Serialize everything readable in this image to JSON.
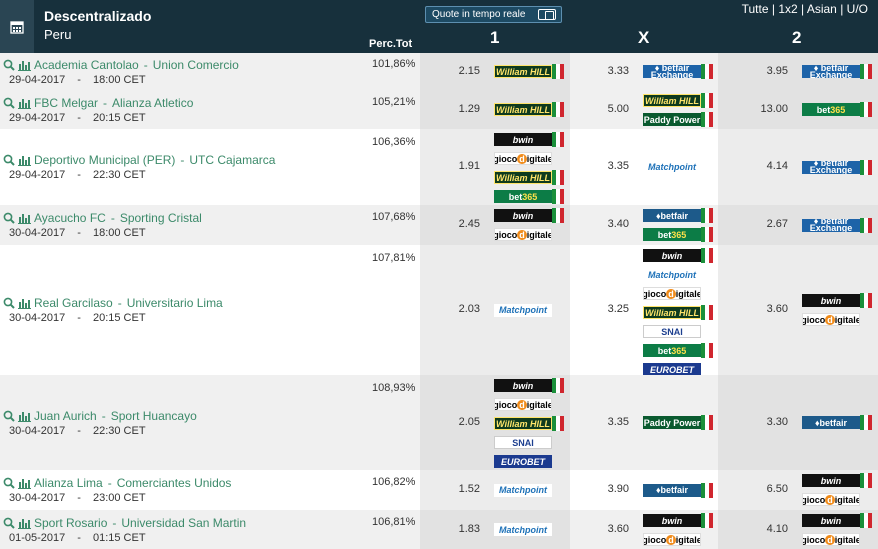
{
  "header": {
    "title": "Descentralizado",
    "subtitle": "Peru",
    "live_label": "Quote in tempo reale",
    "filters": [
      "Tutte",
      "1x2",
      "Asian",
      "U/O"
    ],
    "perc_label": "Perc.Tot",
    "col1": "1",
    "colx": "X",
    "col2": "2"
  },
  "matches": [
    {
      "home": "Academia Cantolao",
      "away": "Union Comercio",
      "date": "29-04-2017",
      "time": "18:00 CET",
      "perc": "101,86%",
      "odd1": "2.15",
      "oddx": "3.33",
      "odd2": "3.95",
      "bk1": [
        "William Hill"
      ],
      "bkx": [
        "betfair Exchange"
      ],
      "bk2": [
        "betfair Exchange"
      ]
    },
    {
      "home": "FBC Melgar",
      "away": "Alianza Atletico",
      "date": "29-04-2017",
      "time": "20:15 CET",
      "perc": "105,21%",
      "odd1": "1.29",
      "oddx": "5.00",
      "odd2": "13.00",
      "bk1": [
        "William Hill"
      ],
      "bkx": [
        "William Hill",
        "Paddy Power"
      ],
      "bk2": [
        "bet365"
      ]
    },
    {
      "home": "Deportivo Municipal (PER)",
      "away": "UTC Cajamarca",
      "date": "29-04-2017",
      "time": "22:30 CET",
      "perc": "106,36%",
      "odd1": "1.91",
      "oddx": "3.35",
      "odd2": "4.14",
      "bk1": [
        "bwin",
        "gioco digitale",
        "William Hill",
        "bet365"
      ],
      "bkx": [
        "Matchpoint"
      ],
      "bk2": [
        "betfair Exchange"
      ]
    },
    {
      "home": "Ayacucho FC",
      "away": "Sporting Cristal",
      "date": "30-04-2017",
      "time": "18:00 CET",
      "perc": "107,68%",
      "odd1": "2.45",
      "oddx": "3.40",
      "odd2": "2.67",
      "bk1": [
        "bwin",
        "gioco digitale"
      ],
      "bkx": [
        "betfair",
        "bet365"
      ],
      "bk2": [
        "betfair Exchange"
      ]
    },
    {
      "home": "Real Garcilaso",
      "away": "Universitario Lima",
      "date": "30-04-2017",
      "time": "20:15 CET",
      "perc": "107,81%",
      "odd1": "2.03",
      "oddx": "3.25",
      "odd2": "3.60",
      "bk1": [
        "Matchpoint"
      ],
      "bkx": [
        "bwin",
        "Matchpoint",
        "gioco digitale",
        "William Hill",
        "SNAI",
        "bet365",
        "EUROBET"
      ],
      "bk2": [
        "bwin",
        "gioco digitale"
      ]
    },
    {
      "home": "Juan Aurich",
      "away": "Sport Huancayo",
      "date": "30-04-2017",
      "time": "22:30 CET",
      "perc": "108,93%",
      "odd1": "2.05",
      "oddx": "3.35",
      "odd2": "3.30",
      "bk1": [
        "bwin",
        "gioco digitale",
        "William Hill",
        "SNAI",
        "EUROBET"
      ],
      "bkx": [
        "Paddy Power"
      ],
      "bk2": [
        "betfair"
      ]
    },
    {
      "home": "Alianza Lima",
      "away": "Comerciantes Unidos",
      "date": "30-04-2017",
      "time": "23:00 CET",
      "perc": "106,82%",
      "odd1": "1.52",
      "oddx": "3.90",
      "odd2": "6.50",
      "bk1": [
        "Matchpoint"
      ],
      "bkx": [
        "betfair"
      ],
      "bk2": [
        "bwin",
        "gioco digitale"
      ]
    },
    {
      "home": "Sport Rosario",
      "away": "Universidad San Martin",
      "date": "01-05-2017",
      "time": "01:15 CET",
      "perc": "106,81%",
      "odd1": "1.83",
      "oddx": "3.60",
      "odd2": "4.10",
      "bk1": [
        "Matchpoint"
      ],
      "bkx": [
        "bwin",
        "gioco digitale"
      ],
      "bk2": [
        "bwin",
        "gioco digitale"
      ]
    }
  ]
}
